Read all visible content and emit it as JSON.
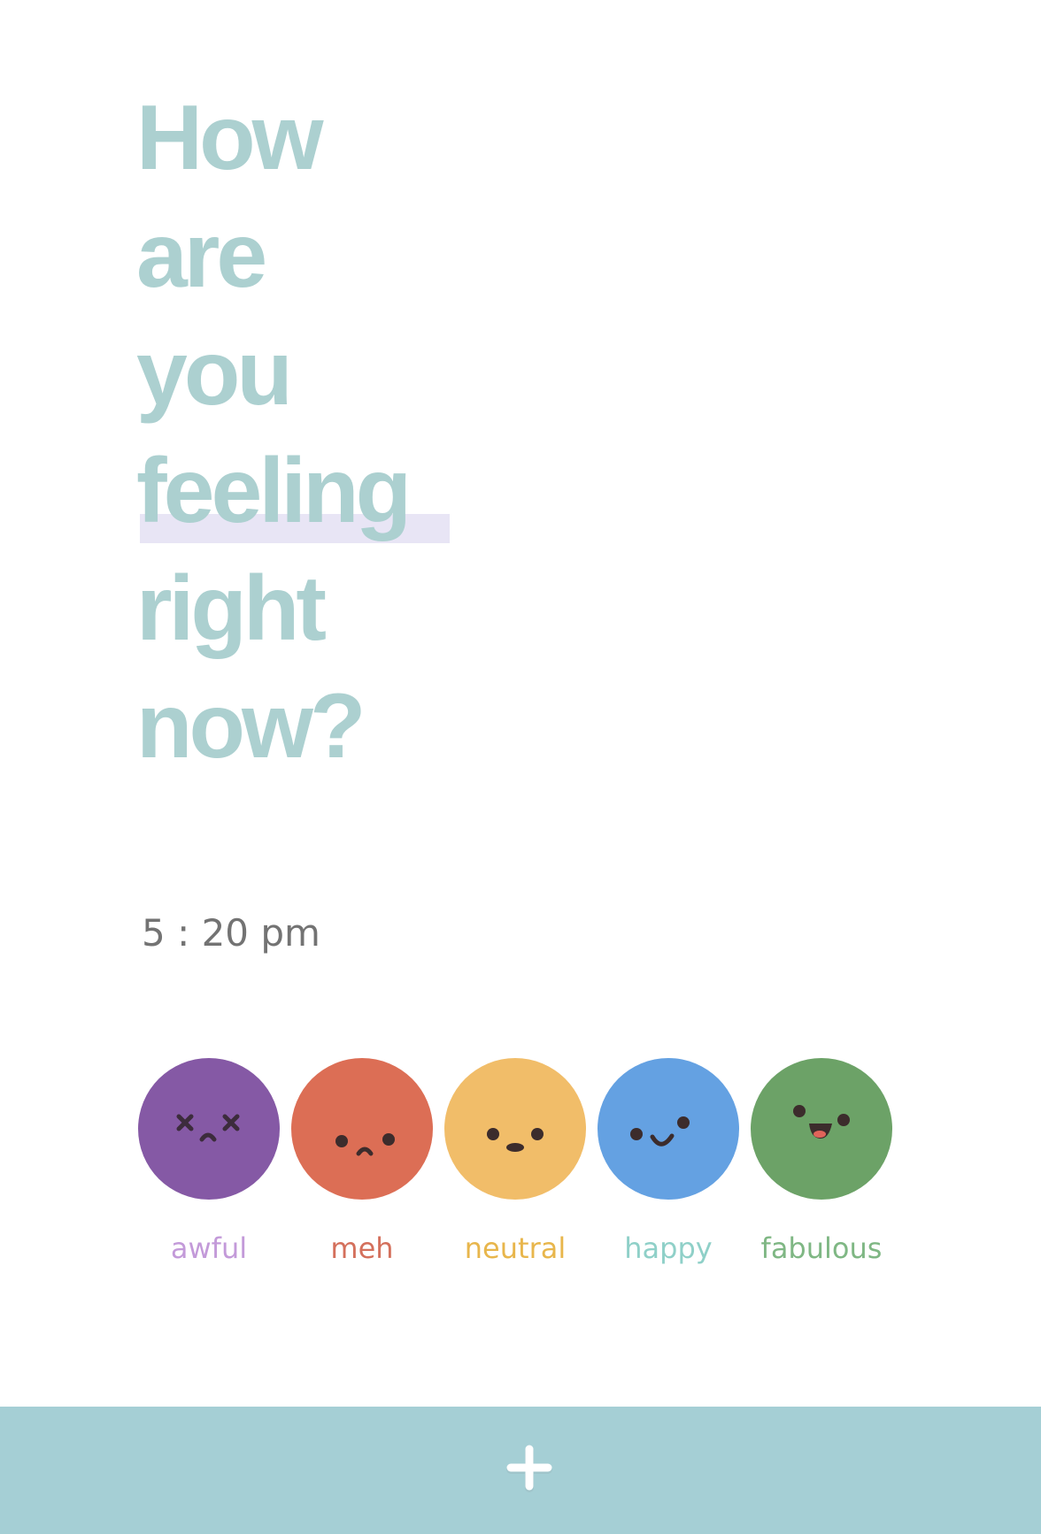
{
  "question": {
    "words": [
      "How",
      "are",
      "you",
      "feeling",
      "right",
      "now?"
    ],
    "color": "#acd0d0",
    "highlight_color": "#e8e5f5"
  },
  "time": {
    "text": "5 : 20 pm"
  },
  "moods": [
    {
      "label": "awful",
      "face_color": "#8559a5",
      "label_color": "#c39ad9",
      "icon": "dead-face-icon"
    },
    {
      "label": "meh",
      "face_color": "#dc6e55",
      "label_color": "#d4705c",
      "icon": "frown-face-icon"
    },
    {
      "label": "neutral",
      "face_color": "#f1bd69",
      "label_color": "#e8b64c",
      "icon": "neutral-face-icon"
    },
    {
      "label": "happy",
      "face_color": "#64a1e2",
      "label_color": "#8fd0c8",
      "icon": "smile-face-icon"
    },
    {
      "label": "fabulous",
      "face_color": "#6ca267",
      "label_color": "#7fb784",
      "icon": "grin-face-icon"
    }
  ],
  "bottom_bar": {
    "color": "#a5cfd5",
    "add_icon": "plus-icon"
  }
}
